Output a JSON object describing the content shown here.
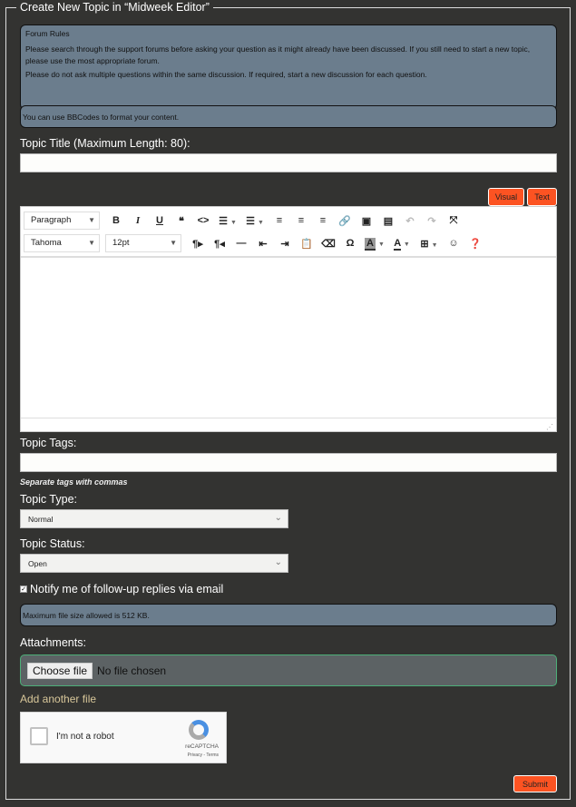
{
  "title": "Create New Topic in “Midweek Editor”",
  "forum_rules": {
    "heading": "Forum Rules",
    "p1": "Please search through the support forums before asking your question as it might already have been discussed. If you still need to start a new topic, please use the most appropriate forum.",
    "p2": "Please do not ask multiple questions within the same discussion. If required, start a new discussion for each question."
  },
  "bbcode_note": "You can use BBCodes to format your content.",
  "topic_title": {
    "label": "Topic Title (Maximum Length: 80):",
    "value": ""
  },
  "editor": {
    "visual_tab": "Visual",
    "text_tab": "Text",
    "format": "Paragraph",
    "font": "Tahoma",
    "size": "12pt",
    "icons_row1": [
      "bold-icon",
      "italic-icon",
      "underline-icon",
      "blockquote-icon",
      "code-icon",
      "bullet-list-icon",
      "numbered-list-icon",
      "align-left-icon",
      "align-center-icon",
      "align-right-icon",
      "link-icon",
      "image-icon",
      "media-icon",
      "undo-icon",
      "redo-icon",
      "fullscreen-icon"
    ],
    "icons_row2": [
      "ltr-icon",
      "rtl-icon",
      "horizontal-rule-icon",
      "outdent-icon",
      "indent-icon",
      "paste-icon",
      "eraser-icon",
      "omega-icon",
      "background-color-icon",
      "text-color-icon",
      "table-icon",
      "emoticon-icon",
      "help-icon"
    ]
  },
  "topic_tags": {
    "label": "Topic Tags:",
    "value": "",
    "hint": "Separate tags with commas"
  },
  "topic_type": {
    "label": "Topic Type:",
    "selected": "Normal"
  },
  "topic_status": {
    "label": "Topic Status:",
    "selected": "Open"
  },
  "notify": {
    "label": "Notify me of follow-up replies via email",
    "checked": true
  },
  "max_file": "Maximum file size allowed is 512 KB.",
  "attachments": {
    "label": "Attachments:",
    "choose": "Choose file",
    "status": "No file chosen",
    "add_another": "Add another file"
  },
  "captcha": {
    "label": "I'm not a robot",
    "brand": "reCAPTCHA",
    "links": "Privacy - Terms"
  },
  "submit": "Submit",
  "colors": {
    "accent": "#fc5322",
    "info_bg": "#6b7d8d",
    "page_bg": "#333331",
    "link": "#d8c79a"
  }
}
